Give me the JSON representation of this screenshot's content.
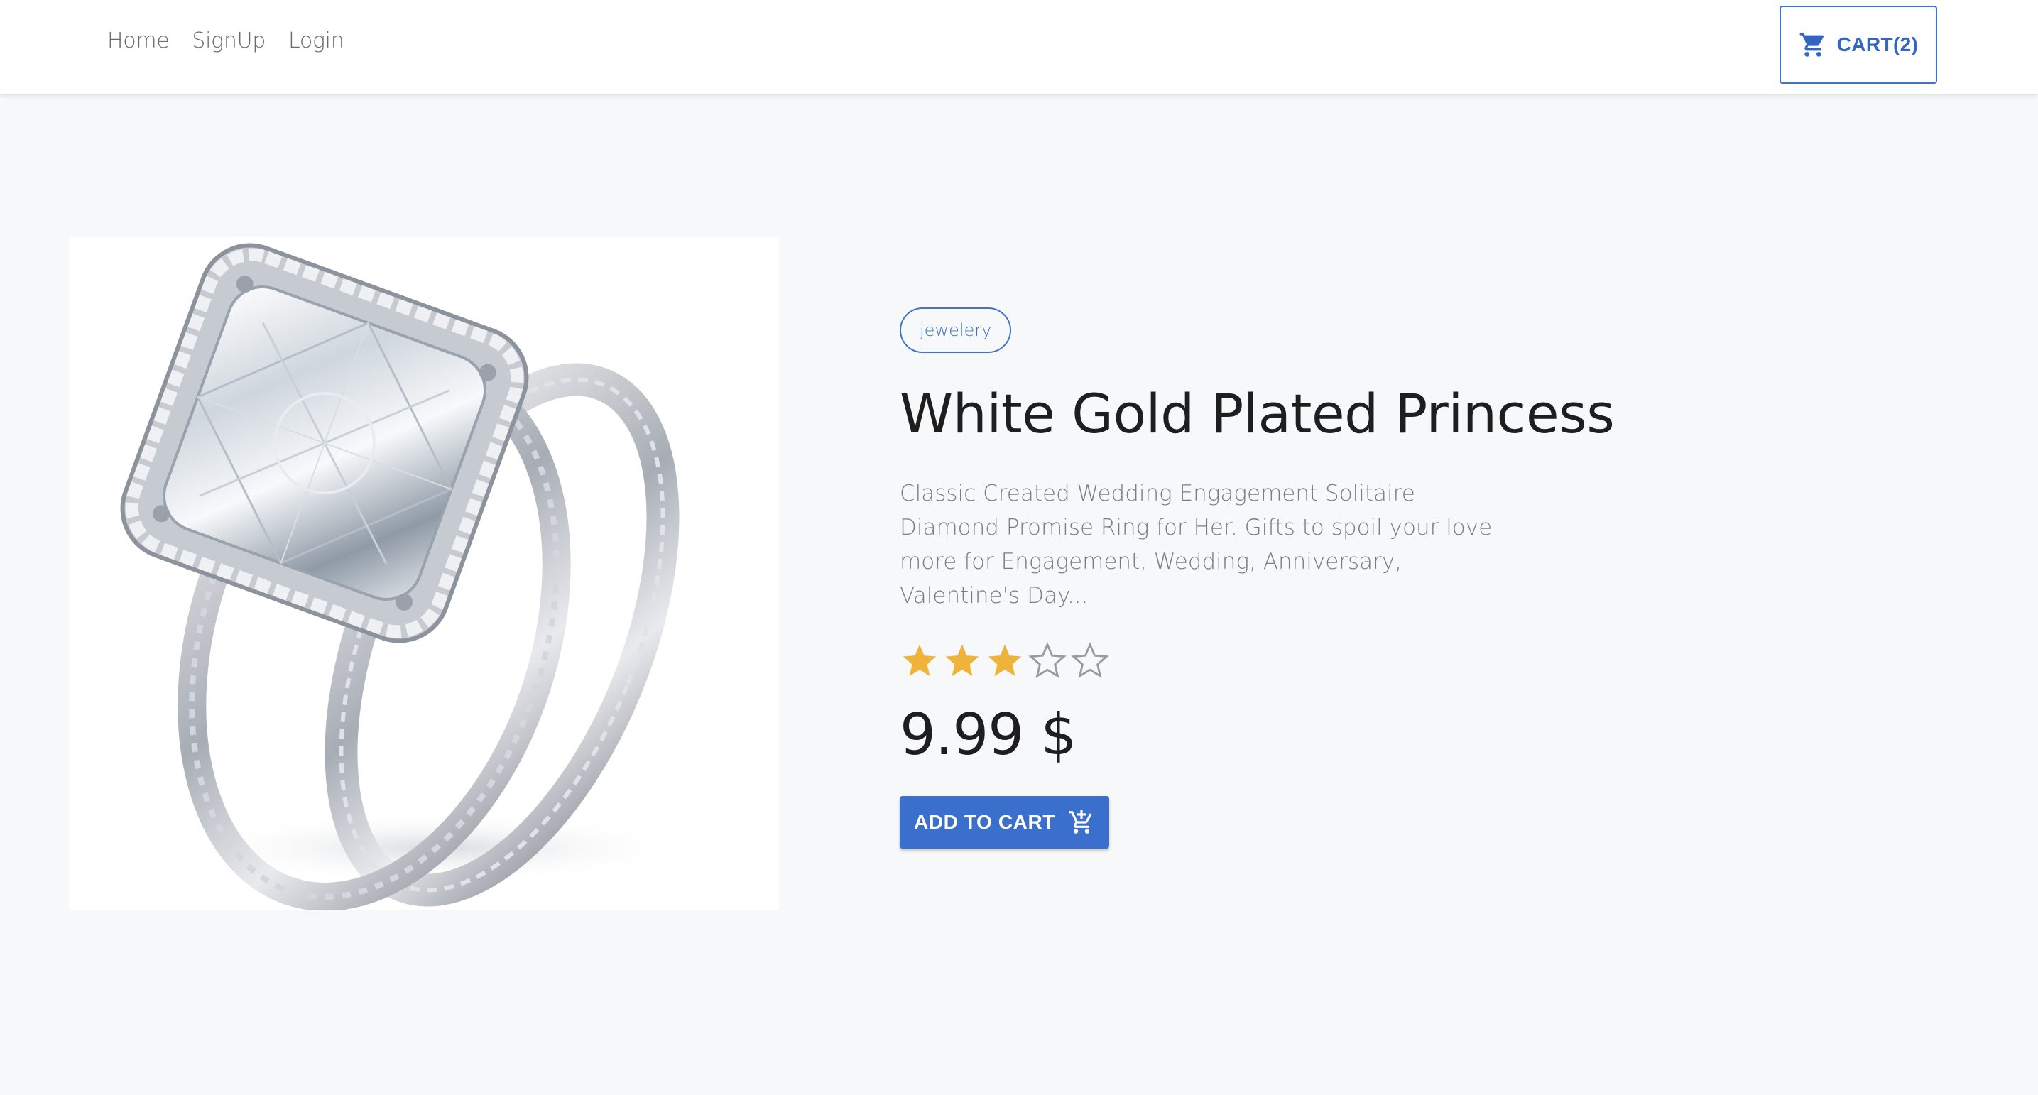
{
  "nav": {
    "links": [
      "Home",
      "SignUp",
      "Login"
    ],
    "cart_label": "CART(2)",
    "cart_icon": "shopping-cart-icon"
  },
  "product": {
    "image_alt": "Diamond ring set",
    "category": "jewelery",
    "title": "White Gold Plated Princess",
    "description": "Classic Created Wedding Engagement Solitaire Diamond Promise Ring for Her. Gifts to spoil your love more for Engagement, Wedding, Anniversary, Valentine's Day...",
    "rating": {
      "value": 3,
      "max": 5
    },
    "price": "9.99 $",
    "add_to_cart_label": "ADD TO CART",
    "add_to_cart_icon": "add-shopping-cart-icon"
  },
  "colors": {
    "accent": "#3a6fcc",
    "star_filled": "#f0b33a",
    "star_empty": "#9a9a9a",
    "background": "#f7f8fa"
  }
}
